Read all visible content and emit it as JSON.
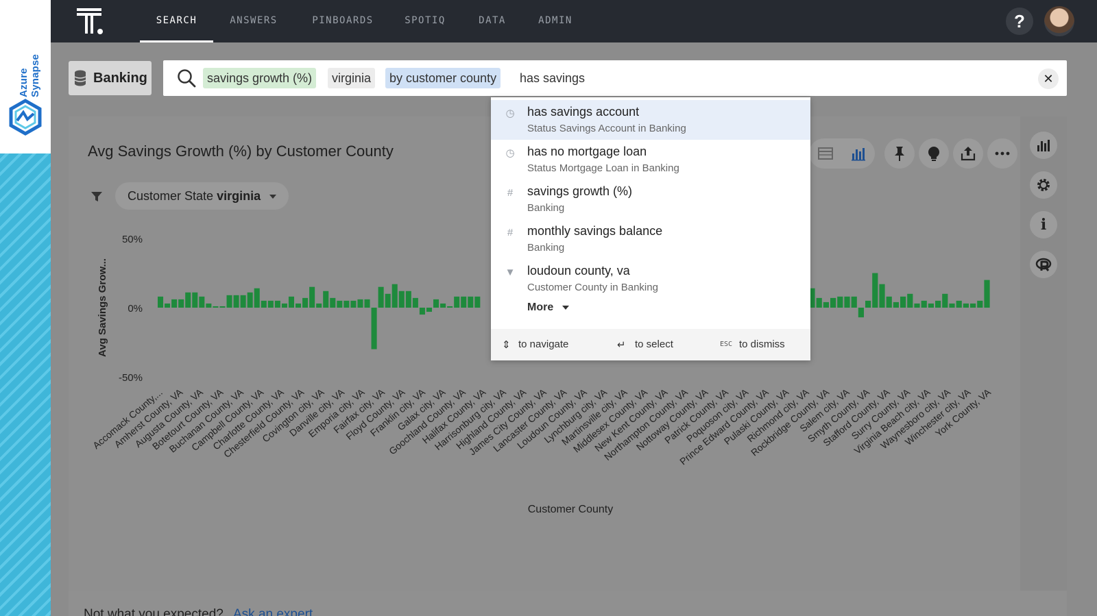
{
  "brand": {
    "text": "Azure Synapse"
  },
  "nav": {
    "items": [
      {
        "label": "SEARCH",
        "active": true
      },
      {
        "label": "ANSWERS",
        "active": false
      },
      {
        "label": "PINBOARDS",
        "active": false
      },
      {
        "label": "SPOTIQ",
        "active": false
      },
      {
        "label": "DATA",
        "active": false
      },
      {
        "label": "ADMIN",
        "active": false
      }
    ],
    "help": "?"
  },
  "source": {
    "label": "Banking"
  },
  "search": {
    "tokens": [
      {
        "text": "savings growth (%)",
        "kind": "measure"
      },
      {
        "text": "virginia",
        "kind": "value"
      },
      {
        "text": "by customer county",
        "kind": "attribute"
      }
    ],
    "typed": "has savings",
    "clear": "✕"
  },
  "answer": {
    "title": "Avg Savings Growth (%) by Customer County",
    "filter": {
      "label": "Customer State",
      "value": "virginia"
    }
  },
  "suggestions": [
    {
      "icon": "clock-icon",
      "main": "has savings account",
      "sub": "Status Savings Account in Banking",
      "highlighted": true
    },
    {
      "icon": "clock-icon",
      "main": "has no mortgage loan",
      "sub": "Status Mortgage Loan in Banking",
      "highlighted": false
    },
    {
      "icon": "hash-icon",
      "main": "savings growth (%)",
      "sub": "Banking",
      "highlighted": false
    },
    {
      "icon": "hash-icon",
      "main": "monthly savings balance",
      "sub": "Banking",
      "highlighted": false
    },
    {
      "icon": "filter-icon",
      "main": "loudoun county, va",
      "sub": "Customer County in Banking",
      "highlighted": false
    }
  ],
  "more_label": "More",
  "dropdown_footer": {
    "navigate": "to navigate",
    "select": "to select",
    "esc_key": "ESC",
    "dismiss": "to dismiss"
  },
  "footer": {
    "not_expected": "Not what you expected?",
    "ask_expert": "Ask an expert"
  },
  "colors": {
    "bar": "#1e8a3c",
    "accent": "#1d4f91",
    "nav_bg": "#262a31"
  },
  "chart_data": {
    "type": "bar",
    "xlabel": "Customer County",
    "ylabel": "Avg Savings Grow...",
    "ylim": [
      -50,
      50
    ],
    "yticks": [
      "50%",
      "0%",
      "-50%"
    ],
    "tick_labels": [
      "Accomack County,...",
      "Amherst County, VA",
      "Augusta County, VA",
      "Botetourt County, VA",
      "Buchanan County, VA",
      "Campbell County, VA",
      "Charlotte County, VA",
      "Chesterfield County, VA",
      "Covington city, VA",
      "Danville city, VA",
      "Emporia city, VA",
      "Fairfax city, VA",
      "Floyd County, VA",
      "Franklin city, VA",
      "Galax city, VA",
      "Goochland County, VA",
      "Halifax County, VA",
      "Harrisonburg city, VA",
      "Highland County, VA",
      "James City County, VA",
      "Lancaster County, VA",
      "Loudoun County, VA",
      "Lynchburg city, VA",
      "Martinsville city, VA",
      "Middlesex County, VA",
      "New Kent County, VA",
      "Northampton County, VA",
      "Nottoway County, VA",
      "Patrick County, VA",
      "Poquoson city, VA",
      "Prince Edward County, VA",
      "Pulaski County, VA",
      "Richmond city, VA",
      "Rockbridge County, VA",
      "Salem city, VA",
      "Smyth County, VA",
      "Stafford County, VA",
      "Surry County, VA",
      "Virginia Beach city, VA",
      "Waynesboro city, VA",
      "Winchester city, VA",
      "York County, VA"
    ],
    "values_left": [
      8,
      3,
      6,
      6,
      11,
      11,
      8,
      3,
      1,
      1,
      9,
      9,
      9,
      11,
      14,
      5,
      5,
      5,
      3,
      8,
      3,
      7,
      15,
      3,
      12,
      7,
      5,
      5,
      5,
      6,
      6,
      -30,
      15,
      10,
      17,
      12,
      12,
      7,
      -5,
      -3,
      6,
      3,
      1,
      8,
      8,
      8,
      8
    ],
    "values_right": [
      4,
      4,
      14,
      7,
      4,
      7,
      8,
      8,
      8,
      -7,
      5,
      25,
      17,
      8,
      4,
      8,
      10,
      3,
      5,
      3,
      5,
      10,
      3,
      5,
      3,
      3,
      5,
      20
    ]
  }
}
